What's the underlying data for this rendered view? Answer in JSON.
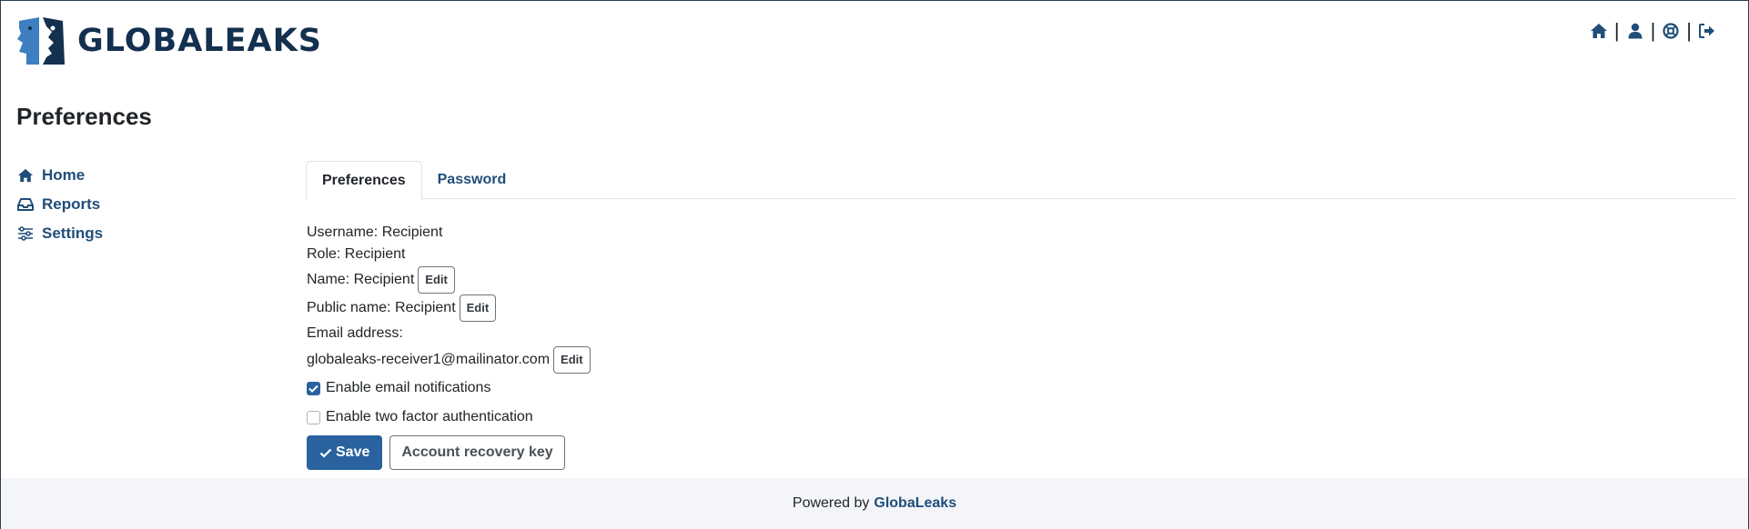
{
  "header": {
    "logo_text": "GLOBALEAKS",
    "icons": [
      "home-icon",
      "user-icon",
      "lifebuoy-icon",
      "logout-icon"
    ]
  },
  "page": {
    "title": "Preferences"
  },
  "sidebar": {
    "items": [
      {
        "label": "Home",
        "icon": "home-icon"
      },
      {
        "label": "Reports",
        "icon": "inbox-icon"
      },
      {
        "label": "Settings",
        "icon": "sliders-icon"
      }
    ]
  },
  "tabs": [
    {
      "label": "Preferences",
      "active": true
    },
    {
      "label": "Password",
      "active": false
    }
  ],
  "profile": {
    "username": "Username: Recipient",
    "role": "Role: Recipient",
    "name": "Name: Recipient",
    "public_name": "Public name: Recipient",
    "email_label": "Email address:",
    "email_value": "globaleaks-receiver1@mailinator.com",
    "edit_label": "Edit"
  },
  "options": {
    "email_notifications": {
      "label": "Enable email notifications",
      "checked": true
    },
    "two_factor": {
      "label": "Enable two factor authentication",
      "checked": false
    }
  },
  "actions": {
    "save_label": "Save",
    "recovery_label": "Account recovery key"
  },
  "footer": {
    "powered_by": "Powered by",
    "brand": "GlobaLeaks"
  },
  "colors": {
    "primary": "#2a62a0",
    "link": "#1f4e79",
    "logo_dark": "#13304f",
    "logo_light": "#3d7fc1",
    "footer_bg": "#f4f5f8"
  }
}
